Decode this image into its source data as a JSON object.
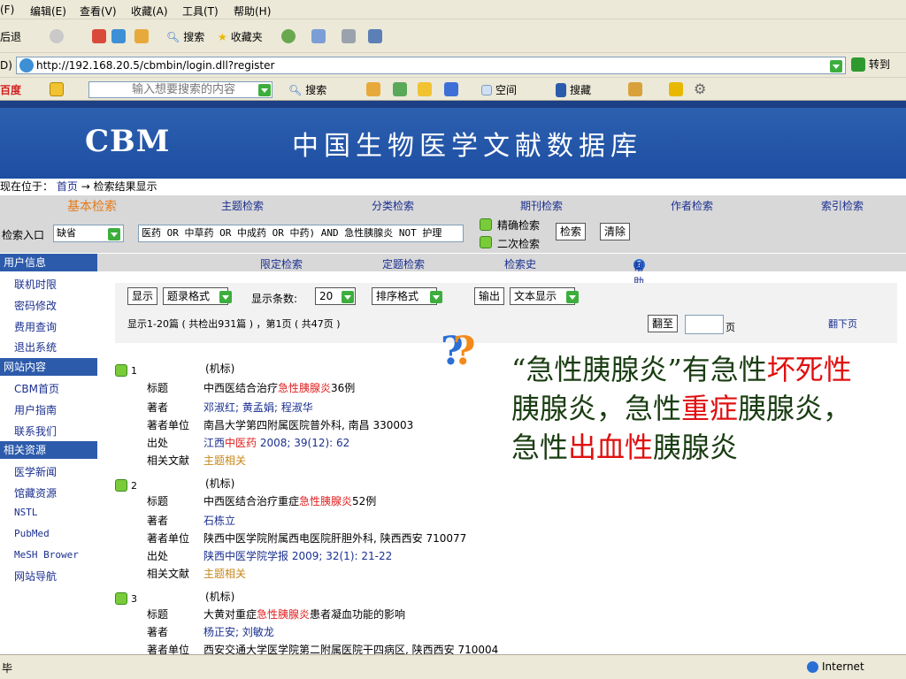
{
  "menu": [
    "(F)",
    "编辑(E)",
    "查看(V)",
    "收藏(A)",
    "工具(T)",
    "帮助(H)"
  ],
  "toolbar": {
    "back_label": "后退",
    "search_label": "搜索",
    "favorites_label": "收藏夹"
  },
  "address": {
    "label": "D)",
    "url": "http://192.168.20.5/cbmbin/login.dll?register",
    "go_label": "转到"
  },
  "linkbar": {
    "brand": "百度",
    "search_placeholder": "输入想要搜索的内容",
    "search_label": "搜索",
    "space_label": "空间",
    "collect_label": "搜藏"
  },
  "banner": {
    "logo": "CBM",
    "title": "中国生物医学文献数据库"
  },
  "location": {
    "prefix": "现在位于：",
    "home": "首页",
    "arrow": "→",
    "current": "检索结果显示"
  },
  "tabs": [
    "基本检索",
    "主题检索",
    "分类检索",
    "期刊检索",
    "作者检索",
    "索引检索"
  ],
  "search": {
    "entry_label": "检索入口",
    "field_value": "缺省",
    "query": "医药 OR 中草药 OR 中成药 OR 中药) AND 急性胰腺炎 NOT 护理",
    "exact_label": "精确检索",
    "secondary_label": "二次检索",
    "search_button": "检索",
    "clear_button": "清除"
  },
  "subnav": [
    "限定检索",
    "定题检索",
    "检索史",
    "帮助"
  ],
  "sidebar": {
    "sections": [
      {
        "title": "用户信息",
        "items": [
          "联机时限",
          "密码修改",
          "费用查询",
          "退出系统"
        ]
      },
      {
        "title": "网站内容",
        "items": [
          "CBM首页",
          "用户指南",
          "联系我们"
        ]
      },
      {
        "title": "相关资源",
        "items": [
          "医学新闻",
          "馆藏资源",
          "NSTL",
          "PubMed",
          "MeSH Brower",
          "网站导航"
        ]
      }
    ]
  },
  "controls": {
    "display_button": "显示",
    "format_value": "题录格式",
    "count_label": "显示条数:",
    "count_value": "20",
    "sort_value": "排序格式",
    "output_button": "输出",
    "text_value": "文本显示",
    "summary": "显示1-20篇 ( 共检出931篇 ) ，第1页 ( 共47页 )",
    "goto_button": "翻至",
    "page_label": "页",
    "next_page": "翻下页"
  },
  "labels": {
    "title": "标题",
    "author": "著者",
    "affiliation": "著者单位",
    "source": "出处",
    "related": "相关文献",
    "marked": "(机标)"
  },
  "records": [
    {
      "num": "1",
      "title_pre": "中西医结合治疗",
      "title_hl": "急性胰腺炎",
      "title_post": "36例",
      "authors": "邓淑红; 黄孟娟; 程淑华",
      "affiliation": "南昌大学第四附属医院普外科, 南昌 330003",
      "source_pre": "江西",
      "source_hl": "中医药",
      "source_post": " 2008; 39(12): 62",
      "related": "主题相关"
    },
    {
      "num": "2",
      "title_pre": "中西医结合治疗重症",
      "title_hl": "急性胰腺炎",
      "title_post": "52例",
      "authors": "石栋立",
      "affiliation": "陕西中医学院附属西电医院肝胆外科, 陕西西安 710077",
      "source_pre": "陕西中医学院学报",
      "source_hl": "",
      "source_post": " 2009; 32(1): 21-22",
      "related": "主题相关"
    },
    {
      "num": "3",
      "title_pre": "大黄对重症",
      "title_hl": "急性胰腺炎",
      "title_post": "患者凝血功能的影响",
      "authors": "杨正安; 刘敏龙",
      "affiliation": "西安交通大学医学院第二附属医院干四病区, 陕西西安 710004",
      "source_pre": "",
      "source_hl": "",
      "source_post": "",
      "related": ""
    }
  ],
  "overlay": {
    "q_left": "?",
    "q_right": "?",
    "p1": "“急性胰腺炎”有急性",
    "p2": "坏死性",
    "p3": "胰腺炎，急性",
    "p4": "重症",
    "p5": "胰腺炎，急性",
    "p6": "出血性",
    "p7": "胰腺炎"
  },
  "status": {
    "left": "毕",
    "zone": "Internet"
  },
  "colors": {
    "banner": "#2f62b1",
    "tab_active": "#e57a17",
    "link": "#1a2f8f",
    "highlight": "#e02020",
    "sidebar_head": "#2d5bab"
  }
}
